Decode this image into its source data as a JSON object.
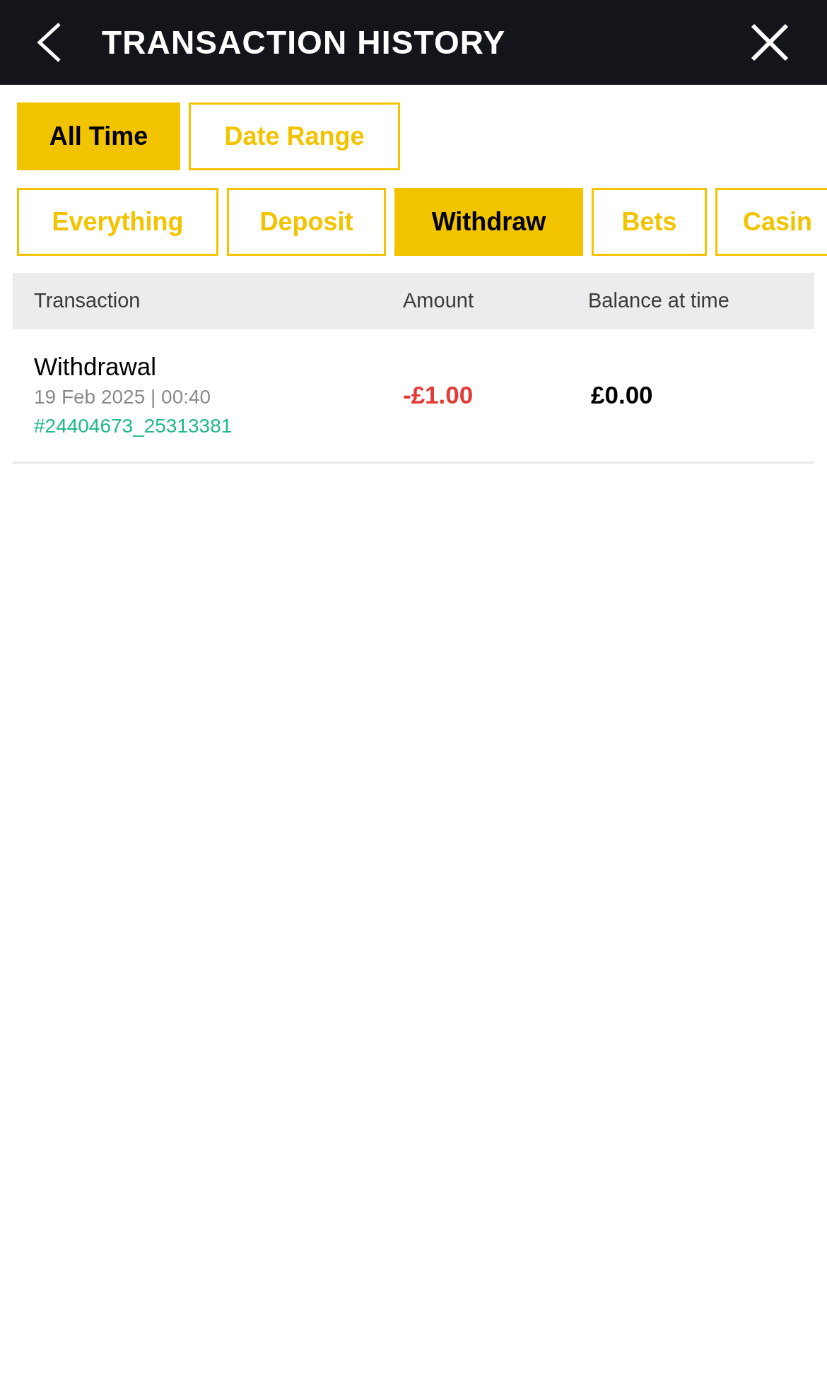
{
  "header": {
    "title": "TRANSACTION HISTORY"
  },
  "period_filters": [
    {
      "label": "All Time",
      "selected": true
    },
    {
      "label": "Date Range",
      "selected": false
    }
  ],
  "type_filters": [
    {
      "label": "Everything",
      "selected": false
    },
    {
      "label": "Deposit",
      "selected": false
    },
    {
      "label": "Withdraw",
      "selected": true
    },
    {
      "label": "Bets",
      "selected": false
    },
    {
      "label": "Casin",
      "selected": false
    }
  ],
  "table": {
    "columns": [
      "Transaction",
      "Amount",
      "Balance at time"
    ],
    "rows": [
      {
        "type": "Withdrawal",
        "datetime": "19 Feb 2025 | 00:40",
        "reference": "#24404673_25313381",
        "amount": "-£1.00",
        "balance": "£0.00"
      }
    ]
  }
}
